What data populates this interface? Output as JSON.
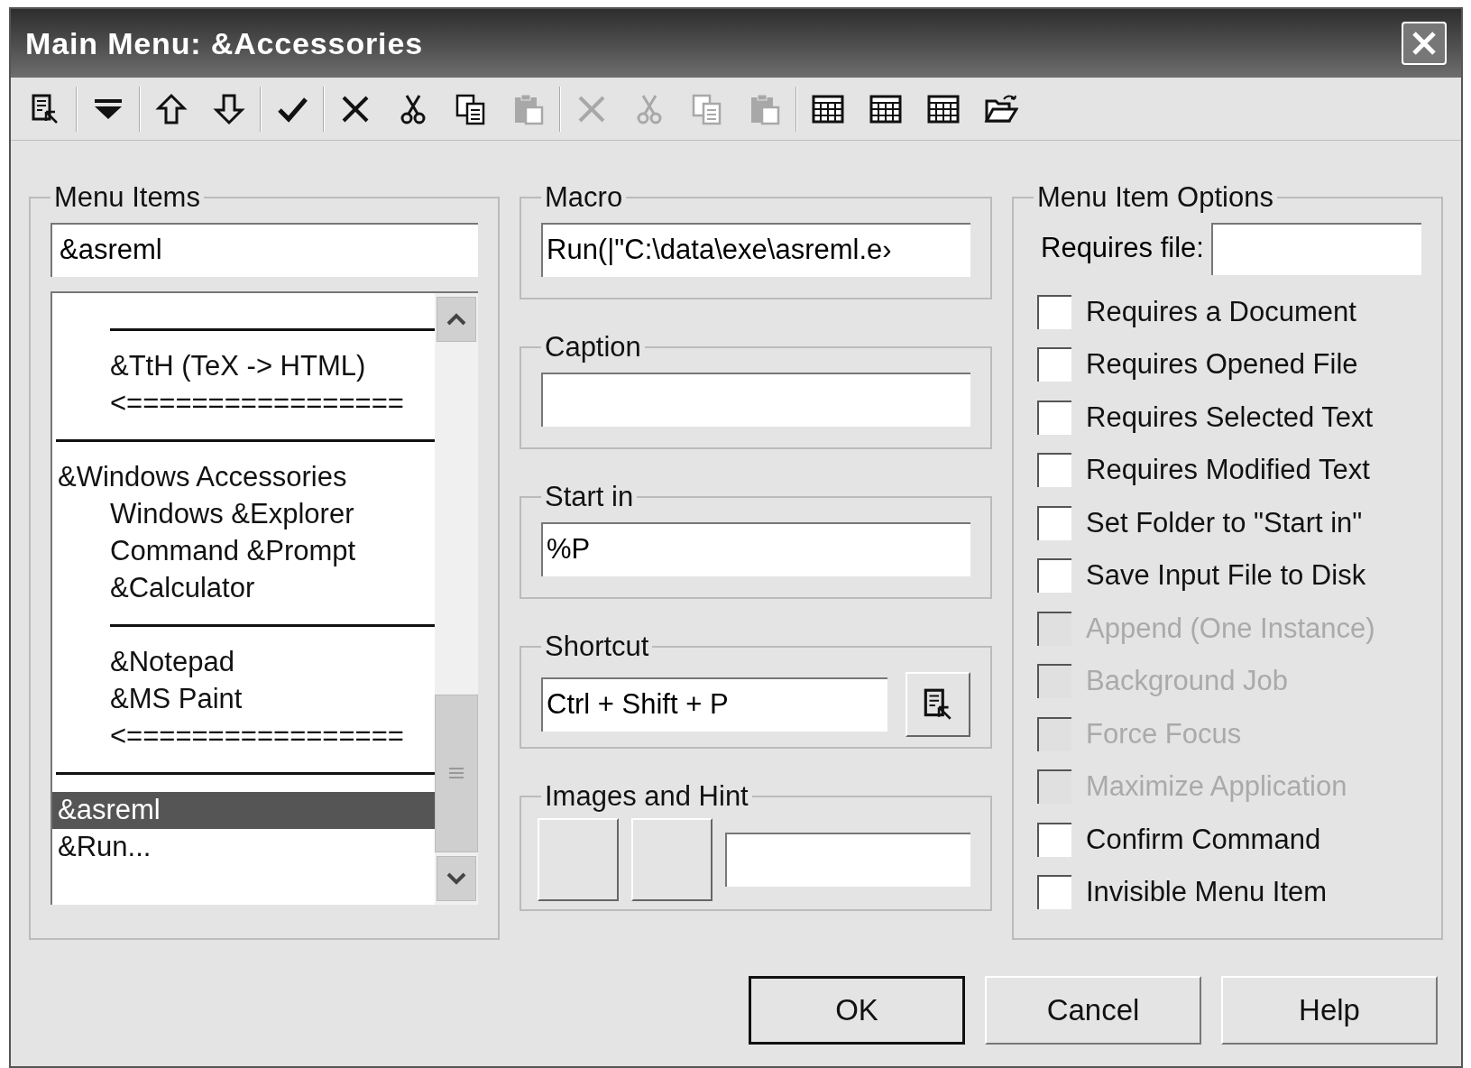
{
  "window": {
    "title": "Main Menu: &Accessories"
  },
  "toolbar": [
    [
      {
        "kind": "properties",
        "disabled": false
      }
    ],
    [
      {
        "kind": "dropdown",
        "disabled": false
      }
    ],
    [
      {
        "kind": "up",
        "disabled": false
      },
      {
        "kind": "down",
        "disabled": false
      }
    ],
    [
      {
        "kind": "check",
        "disabled": false
      }
    ],
    [
      {
        "kind": "delete",
        "disabled": false
      },
      {
        "kind": "cut",
        "disabled": false
      },
      {
        "kind": "copy",
        "disabled": false
      },
      {
        "kind": "paste",
        "disabled": true
      }
    ],
    [
      {
        "kind": "delete",
        "disabled": true
      },
      {
        "kind": "cut",
        "disabled": true
      },
      {
        "kind": "copy",
        "disabled": true
      },
      {
        "kind": "paste",
        "disabled": true
      }
    ],
    [
      {
        "kind": "table",
        "disabled": false
      },
      {
        "kind": "table",
        "disabled": false
      },
      {
        "kind": "table",
        "disabled": false
      },
      {
        "kind": "folder",
        "disabled": false
      }
    ]
  ],
  "menu_items": {
    "legend": "Menu Items",
    "name_value": "&asreml",
    "list": [
      {
        "kind": "continued",
        "children": [
          {
            "kind": "separator"
          },
          {
            "kind": "item",
            "label": "&TtH (TeX -> HTML)",
            "selected": false
          },
          {
            "kind": "item",
            "label": "<=================",
            "selected": false
          }
        ]
      },
      {
        "kind": "separator"
      },
      {
        "kind": "item",
        "label": "&Windows Accessories",
        "selected": false,
        "children": [
          {
            "kind": "item",
            "label": "Windows &Explorer",
            "selected": false
          },
          {
            "kind": "item",
            "label": "Command &Prompt",
            "selected": false
          },
          {
            "kind": "item",
            "label": "&Calculator",
            "selected": false
          },
          {
            "kind": "separator"
          },
          {
            "kind": "item",
            "label": "&Notepad",
            "selected": false
          },
          {
            "kind": "item",
            "label": "&MS Paint",
            "selected": false
          },
          {
            "kind": "item",
            "label": "<=================",
            "selected": false
          }
        ]
      },
      {
        "kind": "separator"
      },
      {
        "kind": "item",
        "label": "&asreml",
        "selected": true
      },
      {
        "kind": "item",
        "label": "&Run...",
        "selected": false
      }
    ]
  },
  "macro": {
    "legend": "Macro",
    "value": "Run(|\"C:\\data\\exe\\asreml.e›"
  },
  "caption": {
    "legend": "Caption"
  },
  "start_in": {
    "legend": "Start in",
    "value": "%P"
  },
  "shortcut": {
    "legend": "Shortcut",
    "value": "Ctrl + Shift + P"
  },
  "images_and_hint": {
    "legend": "Images and Hint"
  },
  "options": {
    "legend": "Menu Item Options",
    "requires_file_label": "Requires file:",
    "checkboxes": [
      {
        "label": "Requires a Document",
        "checked": false,
        "disabled": false
      },
      {
        "label": "Requires Opened File",
        "checked": false,
        "disabled": false
      },
      {
        "label": "Requires Selected Text",
        "checked": false,
        "disabled": false
      },
      {
        "label": "Requires Modified Text",
        "checked": false,
        "disabled": false
      },
      {
        "label": "Set Folder to \"Start in\"",
        "checked": false,
        "disabled": false
      },
      {
        "label": "Save Input File to Disk",
        "checked": false,
        "disabled": false
      },
      {
        "label": "Append (One Instance)",
        "checked": false,
        "disabled": true
      },
      {
        "label": "Background Job",
        "checked": false,
        "disabled": true
      },
      {
        "label": "Force Focus",
        "checked": false,
        "disabled": true
      },
      {
        "label": "Maximize Application",
        "checked": false,
        "disabled": true
      },
      {
        "label": "Confirm Command",
        "checked": false,
        "disabled": false
      },
      {
        "label": "Invisible Menu Item",
        "checked": false,
        "disabled": false
      }
    ]
  },
  "buttons": [
    {
      "label": "OK",
      "default": true
    },
    {
      "label": "Cancel",
      "default": false
    },
    {
      "label": "Help",
      "default": false
    }
  ]
}
